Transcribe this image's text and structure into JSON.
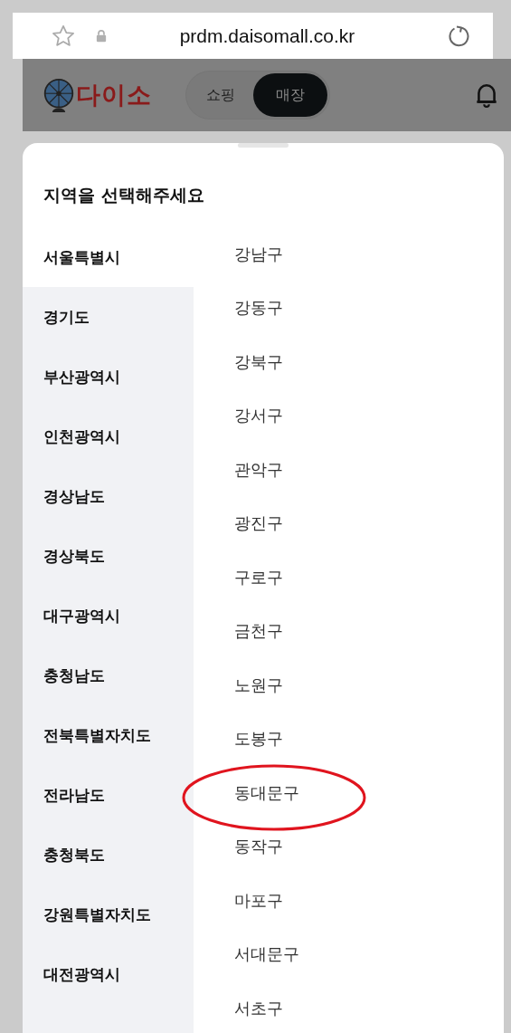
{
  "browser": {
    "url": "prdm.daisomall.co.kr"
  },
  "header": {
    "logo": "다이소",
    "tabs": [
      {
        "label": "쇼핑",
        "selected": false
      },
      {
        "label": "매장",
        "selected": true
      }
    ]
  },
  "sheet": {
    "title": "지역을 선택해주세요",
    "regions": [
      {
        "label": "서울특별시",
        "selected": true
      },
      {
        "label": "경기도",
        "selected": false
      },
      {
        "label": "부산광역시",
        "selected": false
      },
      {
        "label": "인천광역시",
        "selected": false
      },
      {
        "label": "경상남도",
        "selected": false
      },
      {
        "label": "경상북도",
        "selected": false
      },
      {
        "label": "대구광역시",
        "selected": false
      },
      {
        "label": "충청남도",
        "selected": false
      },
      {
        "label": "전북특별자치도",
        "selected": false
      },
      {
        "label": "전라남도",
        "selected": false
      },
      {
        "label": "충청북도",
        "selected": false
      },
      {
        "label": "강원특별자치도",
        "selected": false
      },
      {
        "label": "대전광역시",
        "selected": false
      }
    ],
    "districts": [
      {
        "label": "강남구",
        "circled": false
      },
      {
        "label": "강동구",
        "circled": false
      },
      {
        "label": "강북구",
        "circled": false
      },
      {
        "label": "강서구",
        "circled": false
      },
      {
        "label": "관악구",
        "circled": false
      },
      {
        "label": "광진구",
        "circled": false
      },
      {
        "label": "구로구",
        "circled": false
      },
      {
        "label": "금천구",
        "circled": false
      },
      {
        "label": "노원구",
        "circled": false
      },
      {
        "label": "도봉구",
        "circled": false
      },
      {
        "label": "동대문구",
        "circled": true
      },
      {
        "label": "동작구",
        "circled": false
      },
      {
        "label": "마포구",
        "circled": false
      },
      {
        "label": "서대문구",
        "circled": false
      },
      {
        "label": "서초구",
        "circled": false
      }
    ]
  }
}
